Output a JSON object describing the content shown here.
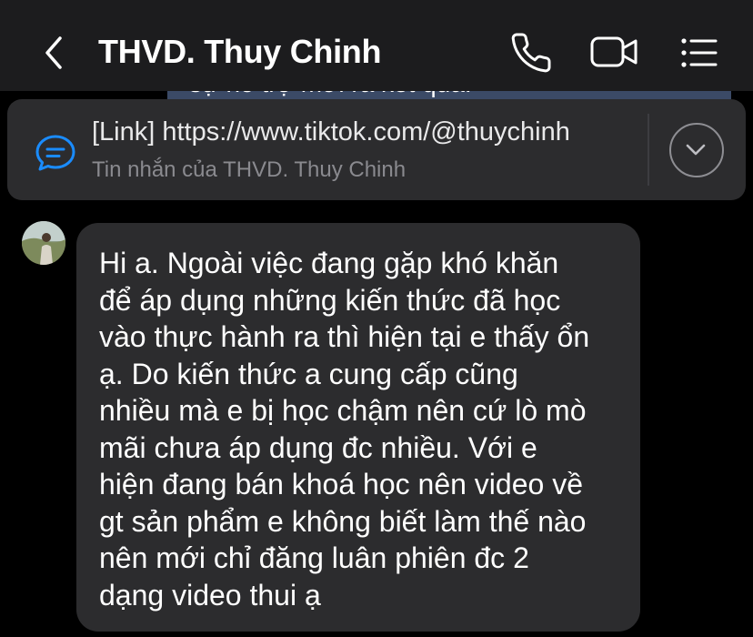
{
  "header": {
    "title": "THVD. Thuy Chinh",
    "icons": {
      "back": "chevron-left-icon",
      "call": "phone-icon",
      "video": "video-camera-icon",
      "menu": "list-menu-icon"
    }
  },
  "previous_message_peek": {
    "text": "sự hỗ trợ mới ra kết quả."
  },
  "pinned_message": {
    "icon": "message-bubble-icon",
    "title": "[Link] https://www.tiktok.com/@thuychinh",
    "subtitle": "Tin nhắn của THVD. Thuy Chinh",
    "expand_icon": "chevron-down-icon"
  },
  "message": {
    "lines": [
      "Hi a. Ngoài việc đang gặp khó khăn",
      "để áp dụng những kiến thức đã học",
      "vào thực hành ra thì hiện tại e thấy ổn",
      "ạ. Do kiến thức a cung cấp cũng",
      "nhiều mà e bị học chậm nên cứ lò mò",
      "mãi chưa áp dụng đc nhiều. Với e",
      "hiện đang bán khoá học nên video về",
      "gt sản phẩm e không biết làm thế nào",
      "nên mới chỉ đăng luân phiên đc 2",
      "dạng video thui ạ"
    ]
  },
  "colors": {
    "header_bg": "#1c1c1e",
    "bubble_bg": "#2c2c2e",
    "accent_blue": "#1a8cff",
    "background": "#000000"
  }
}
